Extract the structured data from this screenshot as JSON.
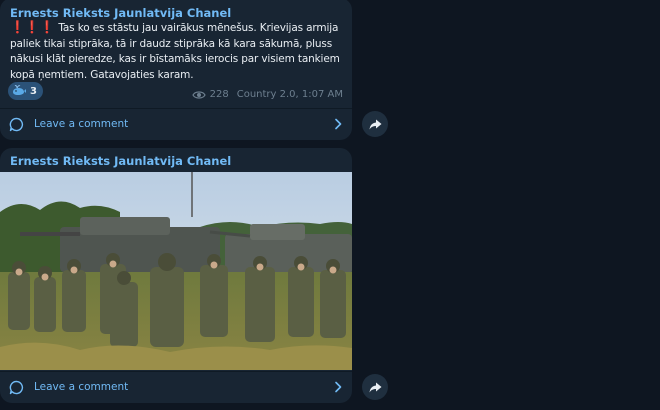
{
  "posts": [
    {
      "channel": "Ernests Rieksts Jaunlatvija Chanel",
      "emoji_prefix": "❗❗❗",
      "text": "Tas ko es stāstu jau vairākus mēnešus. Krievijas armija paliek tikai stiprāka, tā ir daudz stiprāka kā kara sākumā, pluss nākusi klāt pieredze, kas ir bīstamāks ierocis par visiem tankiem kopā ņemtiem. Gatavojaties karam.",
      "reaction": {
        "icon": "whale-emoji",
        "count": "3"
      },
      "views": "228",
      "author_time": "Country 2.0, 1:07 AM",
      "comment_label": "Leave a comment"
    },
    {
      "channel": "Ernests Rieksts Jaunlatvija Chanel",
      "photo": "soldiers-with-armored-vehicles",
      "comment_label": "Leave a comment"
    }
  ],
  "icons": {
    "comment": "comment-bubble-icon",
    "chevron": "chevron-right-icon",
    "share": "share-arrow-icon",
    "views": "eye-icon"
  },
  "colors": {
    "background": "#0e1621",
    "bubble": "#182533",
    "accent": "#71baf5",
    "text": "#e9eef3",
    "meta": "#6d7f8f"
  }
}
